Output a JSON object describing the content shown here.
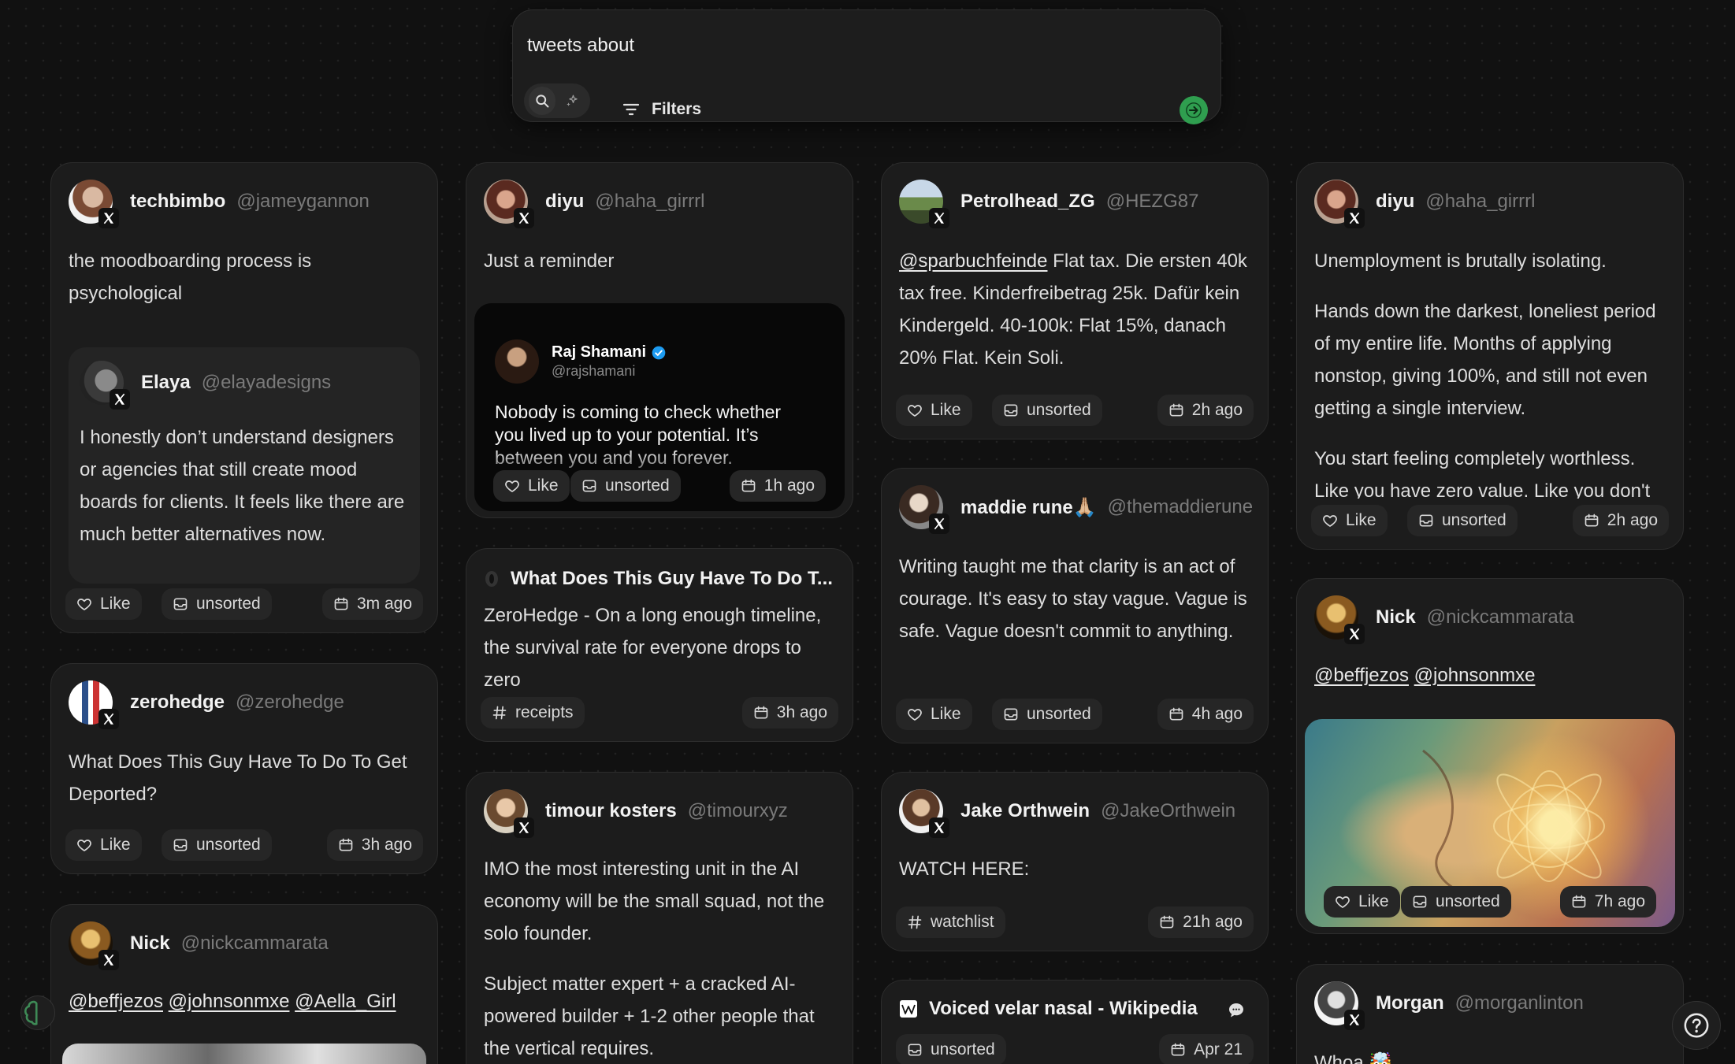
{
  "search": {
    "value": "tweets about",
    "filters_label": "Filters"
  },
  "labels": {
    "like": "Like",
    "unsorted": "unsorted"
  },
  "cards": {
    "c1": {
      "name": "techbimbo",
      "handle": "@jameygannon",
      "text": "the moodboarding process is psychological",
      "quote": {
        "name": "Elaya",
        "handle": "@elayadesigns",
        "text": "I honestly don’t understand designers or agencies that still create mood boards for clients. It feels like there are much better alternatives now."
      },
      "time": "3m ago"
    },
    "c2": {
      "name": "zerohedge",
      "handle": "@zerohedge",
      "text": "What Does This Guy Have To Do To Get Deported?",
      "time": "3h ago"
    },
    "c3": {
      "name": "Nick",
      "handle": "@nickcammarata",
      "mentions": [
        "@beffjezos",
        "@johnsonmxe",
        "@Aella_Girl"
      ]
    },
    "c4": {
      "name": "diyu",
      "handle": "@haha_girrrl",
      "text": "Just a reminder",
      "embed": {
        "name": "Raj Shamani",
        "handle": "@rajshamani",
        "text": "Nobody is coming to check whether you lived up to your potential. It’s between you and you forever."
      },
      "time": "1h ago"
    },
    "c5": {
      "title": "What Does This Guy Have To Do T...",
      "text": "ZeroHedge - On a long enough timeline, the survival rate for everyone drops to zero",
      "tag": "receipts",
      "time": "3h ago"
    },
    "c6": {
      "name": "timour kosters",
      "handle": "@timourxyz",
      "p1": "IMO the most interesting unit in the AI economy will be the small squad, not the solo founder.",
      "p2": "Subject matter expert + a cracked AI-powered builder + 1-2 other people that the vertical requires."
    },
    "c7": {
      "name": "Petrolhead_ZG",
      "handle": "@HEZG87",
      "mention": "@sparbuchfeinde",
      "text": " Flat tax. Die ersten 40k tax free. Kinderfreibetrag 25k. Dafür kein Kindergeld. 40-100k: Flat 15%, danach 20% Flat. Kein Soli.",
      "time": "2h ago"
    },
    "c8": {
      "name": "maddie rune🙏🏼",
      "handle": "@themaddierune",
      "text": "Writing taught me that clarity is an act of courage. It's easy to stay vague. Vague is safe. Vague doesn't commit to anything.",
      "time": "4h ago"
    },
    "c9": {
      "name": "Jake Orthwein",
      "handle": "@JakeOrthwein",
      "text": "WATCH HERE:",
      "tag": "watchlist",
      "time": "21h ago"
    },
    "c10": {
      "title": "Voiced velar nasal - Wikipedia",
      "time": "Apr 21"
    },
    "c11": {
      "name": "diyu",
      "handle": "@haha_girrrl",
      "p1": "Unemployment is brutally isolating.",
      "p2": "Hands down the darkest, loneliest period of my entire life. Months of applying nonstop, giving 100%, and still not even getting a single interview.",
      "p3": "You start feeling completely worthless. Like you have zero value. Like you don't",
      "time": "2h ago"
    },
    "c12": {
      "name": "Nick",
      "handle": "@nickcammarata",
      "mentions": [
        "@beffjezos",
        "@johnsonmxe"
      ],
      "time": "7h ago"
    },
    "c13": {
      "name": "Morgan",
      "handle": "@morganlinton",
      "text": "Whoa 🤯"
    }
  },
  "colors": {
    "background": "#111111",
    "card": "#1c1c1c",
    "pill": "#262626",
    "accent_green": "#2f9e4f"
  }
}
